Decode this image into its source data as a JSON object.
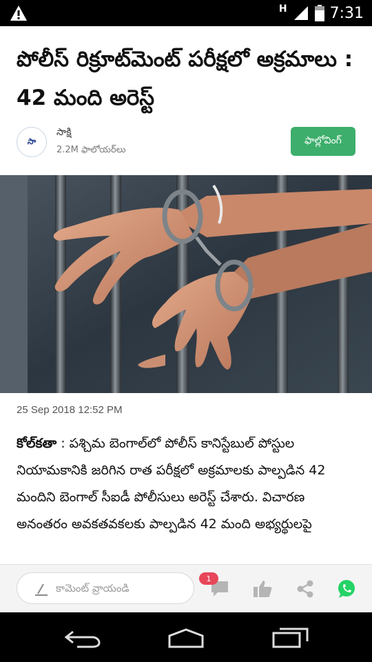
{
  "status_bar": {
    "network_label": "H",
    "time": "7:31",
    "icons": [
      "warning-icon",
      "signal-icon",
      "battery-icon"
    ]
  },
  "article": {
    "title": "పోలీస్ రిక్రూట్‌మెంట్ పరీక్షలో అక్రమాలు : 42 మంది అరెస్ట్",
    "date": "25 Sep 2018 12:52 PM",
    "place": "కోల్‌కతా",
    "body": " : పశ్చిమ బెంగాల్‌లో పోలీస్ కానిస్టేబుల్ పోస్టుల నియామకానికి జరిగిన రాత పరీక్షలో అక్రమాలకు పాల్పడిన 42 మందిని బెంగాల్ సీఐడీ పోలీసులు అరెస్ట్ చేశారు. విచారణ అనంతరం అవకతవకలకు పాల్పడిన 42 మంది అభ్యర్థులపై"
  },
  "publisher": {
    "logo_text": "సా",
    "name": "సాక్షి",
    "followers": "2.2M ఫాలోయర్‌లు",
    "follow_label": "ఫాల్లోవింగ్"
  },
  "comment_bar": {
    "placeholder": "కామెంట్ వ్రాయండి",
    "comment_count": "1",
    "icons": [
      "pen-icon",
      "comment-icon",
      "like-icon",
      "share-icon",
      "whatsapp-icon"
    ]
  },
  "nav_bar": {
    "icons": [
      "back-icon",
      "home-icon",
      "recents-icon"
    ]
  },
  "colors": {
    "follow_button": "#3dae6b",
    "badge": "#e8465a",
    "whatsapp": "#25d366",
    "status_bar": "#000000"
  }
}
